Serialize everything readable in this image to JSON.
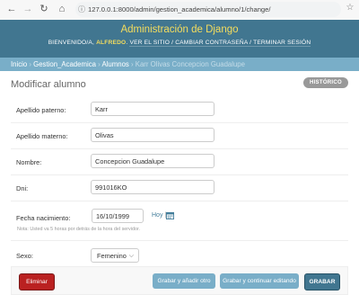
{
  "browser": {
    "url": "127.0.0.1:8000/admin/gestion_academica/alumno/1/change/"
  },
  "header": {
    "site_title": "Administración de Django",
    "welcome": "BIENVENIDO/A,",
    "username": "ALFREDO",
    "links": "VER EL SITIO / CAMBIAR CONTRASEÑA / TERMINAR SESIÓN"
  },
  "breadcrumbs": {
    "home": "Inicio",
    "app": "Gestion_Academica",
    "model": "Alumnos",
    "current": "Karr Olivas Concepcion Guadalupe",
    "sep": "›"
  },
  "page": {
    "title": "Modificar alumno",
    "history_label": "HISTÓRICO"
  },
  "form": {
    "apellido_paterno": {
      "label": "Apellido paterno:",
      "value": "Karr"
    },
    "apellido_materno": {
      "label": "Apellido materno:",
      "value": "Olivas"
    },
    "nombre": {
      "label": "Nombre:",
      "value": "Concepcion Guadalupe"
    },
    "dni": {
      "label": "Dni:",
      "value": "991016KO"
    },
    "fecha_nacimiento": {
      "label": "Fecha nacimiento:",
      "value": "16/10/1999",
      "today_link": "Hoy",
      "sep": "|",
      "help": "Nota: Usted va 5 horas por detrás de la hora del servidor."
    },
    "sexo": {
      "label": "Sexo:",
      "value": "Femenino"
    }
  },
  "actions": {
    "delete": "Eliminar",
    "save_add_another": "Grabar y añadir otro",
    "save_continue": "Grabar y continuar editando",
    "save": "GRABAR"
  },
  "colors": {
    "header_bg": "#417690",
    "breadcrumb_bg": "#79aec8",
    "title_yellow": "#f5dd5d",
    "delete_red": "#ba2121"
  }
}
